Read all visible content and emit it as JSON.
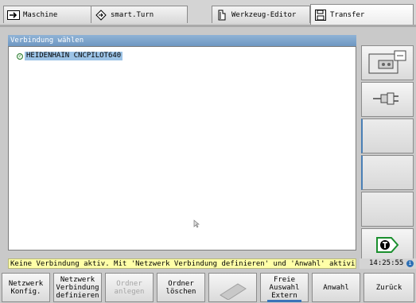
{
  "tabs": [
    {
      "label": "Maschine",
      "icon": "arrow-right-icon"
    },
    {
      "label": "smart.Turn",
      "icon": "diamond-arrow-icon"
    },
    {
      "label": "Werkzeug-Editor",
      "icon": "tool-icon"
    },
    {
      "label": "Transfer",
      "icon": "floppy-disk-icon",
      "active": true
    }
  ],
  "dialog": {
    "title": "Verbindung wählen",
    "connections": [
      {
        "label": "HEIDENHAIN CNCPILOT640",
        "selected": true
      }
    ]
  },
  "status": {
    "message": "Keine Verbindung aktiv. Mit 'Netzwerk Verbindung definieren' und 'Anwahl' aktivieren.",
    "time": "14:25:55"
  },
  "side_softkeys": [
    {
      "icon": "machine-transfer-icon"
    },
    {
      "icon": "connector-icon"
    },
    {
      "icon": ""
    },
    {
      "icon": ""
    },
    {
      "icon": ""
    },
    {
      "icon": "tnc-logo-icon"
    }
  ],
  "softkeys": [
    {
      "label": "Netzwerk\nKonfig.",
      "enabled": true
    },
    {
      "label": "Netzwerk\nVerbindung\ndefinieren",
      "enabled": true
    },
    {
      "label": "Ordner\nanlegen",
      "enabled": false
    },
    {
      "label": "Ordner\nlöschen",
      "enabled": true
    },
    {
      "label": "",
      "enabled": false,
      "icon": "eraser-icon"
    },
    {
      "label": "Freie\nAuswahl\nExtern",
      "enabled": true,
      "active": true
    },
    {
      "label": "Anwahl",
      "enabled": true
    },
    {
      "label": "Zurück",
      "enabled": true
    }
  ]
}
